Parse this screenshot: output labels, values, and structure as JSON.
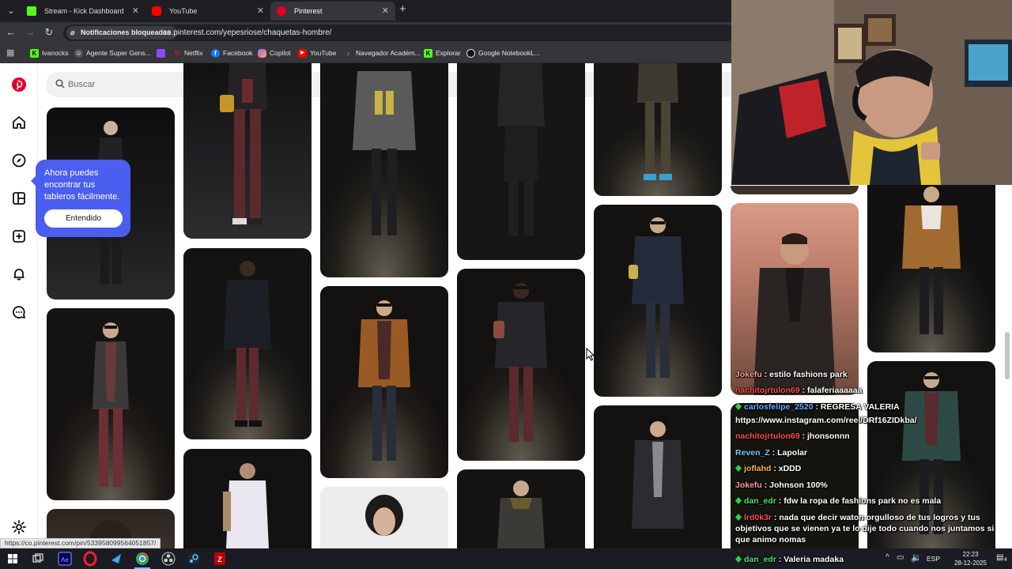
{
  "browser": {
    "tabs": [
      {
        "label": "Stream - Kick Dashboard",
        "icon": "kick-icon",
        "color": "#53fc18"
      },
      {
        "label": "YouTube",
        "icon": "youtube-icon",
        "color": "#ff0000"
      },
      {
        "label": "Pinterest",
        "icon": "pinterest-icon",
        "color": "#e60023",
        "active": true
      }
    ],
    "notifications_pill": "Notificaciones bloqueadas",
    "url": "co.pinterest.com/yepesriose/chaquetas-hombre/",
    "bookmarks": [
      {
        "label": "Ivanocks",
        "icon": "kick-icon",
        "color": "#53fc18"
      },
      {
        "label": "Agente Super Gens...",
        "icon": "agent-icon",
        "color": "#9aa0a6"
      },
      {
        "label": "",
        "icon": "twitch-icon",
        "color": "#9146ff"
      },
      {
        "label": "Netflix",
        "icon": "netflix-icon",
        "color": "#e50914"
      },
      {
        "label": "Facebook",
        "icon": "facebook-icon",
        "color": "#1877f2"
      },
      {
        "label": "Copilot",
        "icon": "copilot-icon",
        "color": "#4ca1e8"
      },
      {
        "label": "YouTube",
        "icon": "youtube-icon",
        "color": "#ff0000"
      },
      {
        "label": "Navegador Académ...",
        "icon": "navigator-icon",
        "color": "#a0a0a0"
      },
      {
        "label": "Explorar",
        "icon": "kick-icon",
        "color": "#53fc18"
      },
      {
        "label": "Google NotebookL...",
        "icon": "notebook-icon",
        "color": "#e8e8e8"
      }
    ]
  },
  "pinterest": {
    "brand_color": "#e60023",
    "search_placeholder": "Buscar",
    "sidebar_icons": [
      "pinterest-logo-icon",
      "home-icon",
      "explore-icon",
      "boards-icon",
      "create-icon",
      "notifications-icon",
      "messages-icon",
      "settings-icon"
    ],
    "tooltip": {
      "text": "Ahora puedes encontrar tus tableros fácilmente.",
      "button": "Entendido"
    },
    "status_url": "https://co.pinterest.com/pin/533958099564051857/"
  },
  "chat": [
    {
      "user": "Jokefu",
      "color": "#ff9a9a",
      "msg": " : estilo fashions park",
      "badge": false
    },
    {
      "user": "nachitojrtulon69",
      "color": "#ff4d4d",
      "msg": " : falaferiaaaaaa",
      "badge": false
    },
    {
      "user": "carlosfelipe_2520",
      "color": "#6fa8ff",
      "msg": " : REGRESA VALERIA",
      "badge": true
    },
    {
      "user": "",
      "color": "#ffffff",
      "msg": "https://www.instagram.com/reel/DRf16ZIDkba/",
      "badge": false
    },
    {
      "user": "nachitojrtulon69",
      "color": "#ff4d4d",
      "msg": " : jhonsonnn",
      "badge": false
    },
    {
      "user": "Reven_Z",
      "color": "#7ec8ff",
      "msg": " : Lapolar",
      "badge": false
    },
    {
      "user": "joflahd",
      "color": "#ffb347",
      "msg": " : xDDD",
      "badge": true
    },
    {
      "user": "Jokefu",
      "color": "#ff9a9a",
      "msg": " : Johnson 100%",
      "badge": false
    },
    {
      "user": "dan_edr",
      "color": "#4ee06b",
      "msg": " : fdw la ropa de fashions park no es mala",
      "badge": true
    },
    {
      "user": "lrd0k3r",
      "color": "#ff4d4d",
      "msg": " : nada que decir waton orgulloso de tus logros y tus objetivos que se vienen ya te lo dije todo cuando nos juntamos si que animo nomas",
      "badge": true
    },
    {
      "user": "dan_edr",
      "color": "#4ee06b",
      "msg": " : Valeria madaka",
      "badge": true
    }
  ],
  "taskbar": {
    "apps": [
      {
        "name": "windows-start-icon",
        "color": "#ffffff"
      },
      {
        "name": "task-view-icon",
        "color": "#dddddd"
      },
      {
        "name": "after-effects-icon",
        "color": "#9999ff"
      },
      {
        "name": "opera-icon",
        "color": "#ff1b2d"
      },
      {
        "name": "app-arrow-icon",
        "color": "#3da8f5"
      },
      {
        "name": "chrome-icon",
        "color": "#34a853"
      },
      {
        "name": "obs-icon",
        "color": "#cccccc"
      },
      {
        "name": "steam-icon",
        "color": "#66c0f4"
      },
      {
        "name": "filezilla-icon",
        "color": "#bf0000"
      }
    ],
    "lang": "ESP",
    "time": "22:23",
    "date": "28-12-2025",
    "notifications_count": "4"
  }
}
